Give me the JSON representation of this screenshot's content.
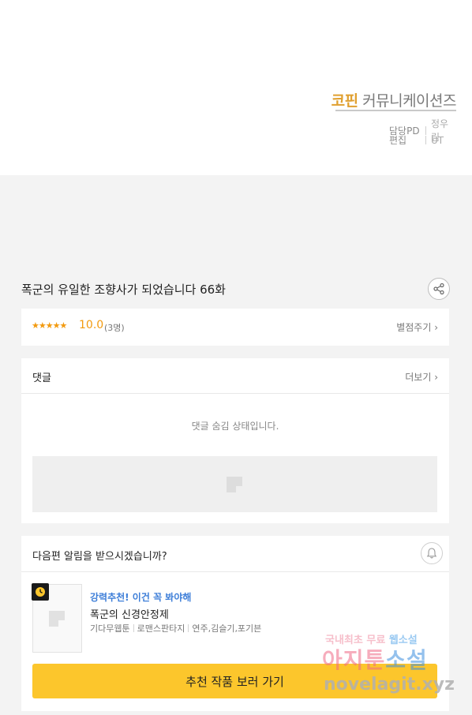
{
  "credits": {
    "studio_brand": "코핀",
    "studio_rest": "커뮤니케이션즈",
    "pd_role": "담당PD",
    "pd_name": "정우림",
    "edit_role": "편집",
    "edit_name": "UT"
  },
  "episode": {
    "title": "폭군의 유일한 조향사가 되었습니다 66화",
    "share_icon": "share-icon"
  },
  "rating": {
    "stars": "★★★★★",
    "score": "10.0",
    "count": "(3명)",
    "rate_link": "별점주기 ›"
  },
  "comments": {
    "title": "댓글",
    "more_link": "더보기 ›",
    "hidden_message": "댓글 숨김 상태입니다."
  },
  "notify": {
    "question": "다음편 알림을 받으시겠습니까?",
    "bell_icon": "bell-icon"
  },
  "recommend": {
    "tag": "강력추천! 이건 꼭 봐야해",
    "title": "폭군의 신경안정제",
    "genre": "기다무웹툰",
    "category": "로맨스판타지",
    "authors": "연주,김슬기,포기븐",
    "cta_label": "추천 작품 보러 가기",
    "badge_icon": "clock-icon"
  },
  "watermark": {
    "top_a": "국내최초 무료 ",
    "top_b": "웹소설",
    "mid_a": "아지툰",
    "mid_b": "소설",
    "bottom": "novelagit.xyz"
  },
  "colors": {
    "accent_star": "#f29a0f",
    "brand": "#e0a030",
    "cta_yellow": "#fcc62c",
    "rec_blue": "#3d7ed8"
  }
}
